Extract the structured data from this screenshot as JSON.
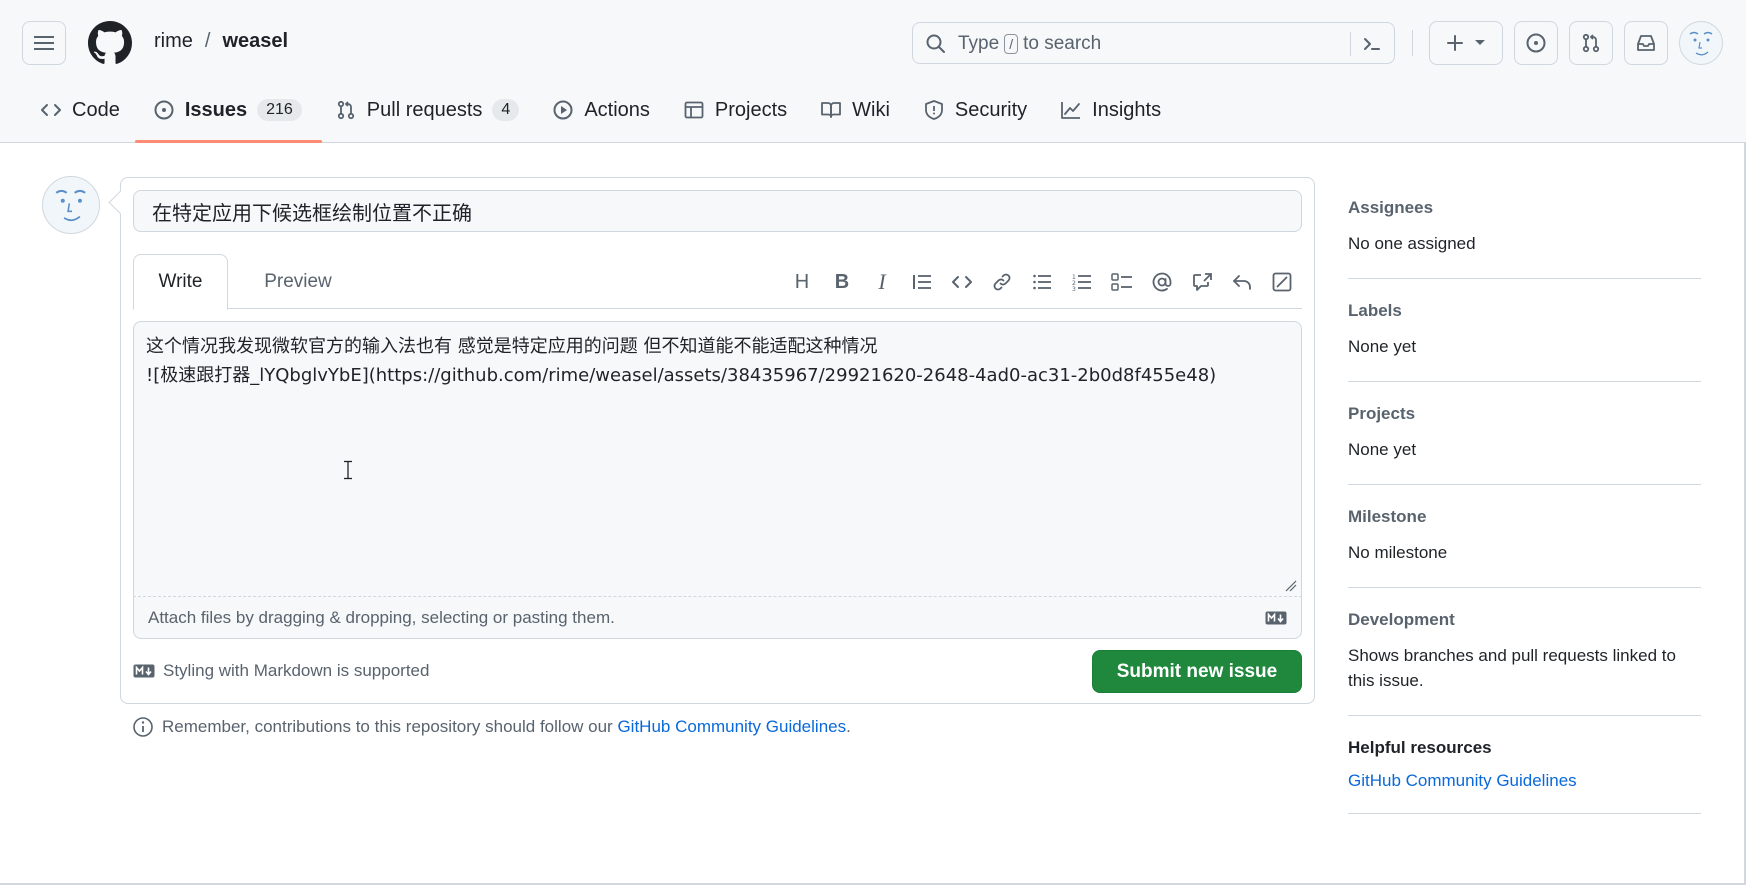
{
  "header": {
    "owner": "rime",
    "separator": "/",
    "repo": "weasel",
    "search_prefix": "Type",
    "search_key": "/",
    "search_suffix": "to search"
  },
  "tabs": [
    {
      "label": "Code",
      "icon": "code-icon"
    },
    {
      "label": "Issues",
      "icon": "issue-opened-icon",
      "count": "216",
      "active": true
    },
    {
      "label": "Pull requests",
      "icon": "git-pull-request-icon",
      "count": "4"
    },
    {
      "label": "Actions",
      "icon": "play-icon"
    },
    {
      "label": "Projects",
      "icon": "table-icon"
    },
    {
      "label": "Wiki",
      "icon": "book-icon"
    },
    {
      "label": "Security",
      "icon": "shield-icon"
    },
    {
      "label": "Insights",
      "icon": "graph-icon"
    }
  ],
  "form": {
    "title_value": "在特定应用下候选框绘制位置不正确",
    "write_tab": "Write",
    "preview_tab": "Preview",
    "body_lines": [
      "这个情况我发现微软官方的输入法也有 感觉是特定应用的问题 但不知道能不能适配这种情况",
      "![极速跟打器_lYQbglvYbE](https://github.com/rime/weasel/assets/38435967/29921620-2648-4ad0-ac31-2b0d8f455e48)"
    ],
    "attach_text": "Attach files by dragging & dropping, selecting or pasting them.",
    "markdown_note": "Styling with Markdown is supported",
    "submit_label": "Submit new issue"
  },
  "remember": {
    "text": "Remember, contributions to this repository should follow our",
    "link": "GitHub Community Guidelines",
    "end": "."
  },
  "sidebar": {
    "assignees_title": "Assignees",
    "assignees_value": "No one assigned",
    "labels_title": "Labels",
    "labels_value": "None yet",
    "projects_title": "Projects",
    "projects_value": "None yet",
    "milestone_title": "Milestone",
    "milestone_value": "No milestone",
    "development_title": "Development",
    "development_value": "Shows branches and pull requests linked to this issue.",
    "helpful_title": "Helpful resources",
    "helpful_link": "GitHub Community Guidelines"
  },
  "colors": {
    "accent_tab": "#fd8c73",
    "submit": "#1f883d",
    "link": "#0969da"
  }
}
